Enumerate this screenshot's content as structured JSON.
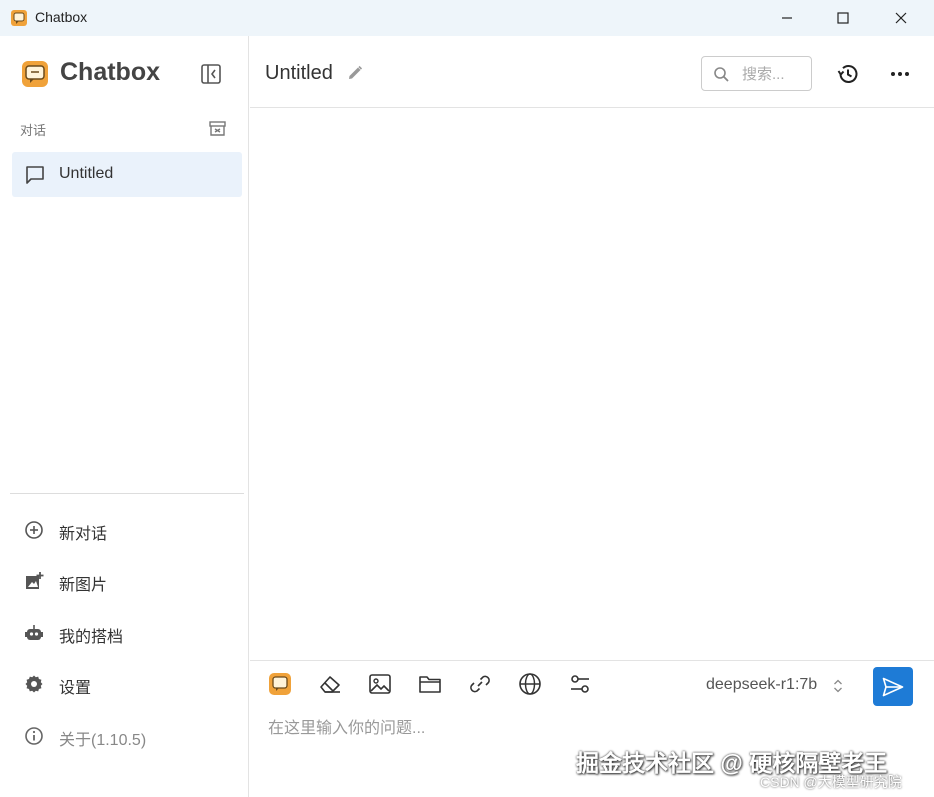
{
  "window": {
    "title": "Chatbox"
  },
  "sidebar": {
    "logo_text": "Chatbox",
    "section_label": "对话",
    "sessions": [
      {
        "label": "Untitled"
      }
    ],
    "menu": [
      {
        "label": "新对话",
        "icon": "add-circle-icon"
      },
      {
        "label": "新图片",
        "icon": "add-photo-icon"
      },
      {
        "label": "我的搭档",
        "icon": "robot-icon"
      },
      {
        "label": "设置",
        "icon": "gear-icon"
      },
      {
        "label": "关于(1.10.5)",
        "icon": "info-icon"
      }
    ]
  },
  "header": {
    "chat_title": "Untitled",
    "search_placeholder": "搜索..."
  },
  "composer": {
    "model": "deepseek-r1:7b",
    "placeholder": "在这里输入你的问题..."
  },
  "watermark": {
    "main": "掘金技术社区 @ 硬核隔壁老王",
    "sub": "CSDN @大模型研究院"
  },
  "colors": {
    "titlebar_bg": "#eef5fa",
    "active_session_bg": "#eaf2fb",
    "send_button": "#1e7bd6",
    "logo_orange": "#f0a23a"
  }
}
